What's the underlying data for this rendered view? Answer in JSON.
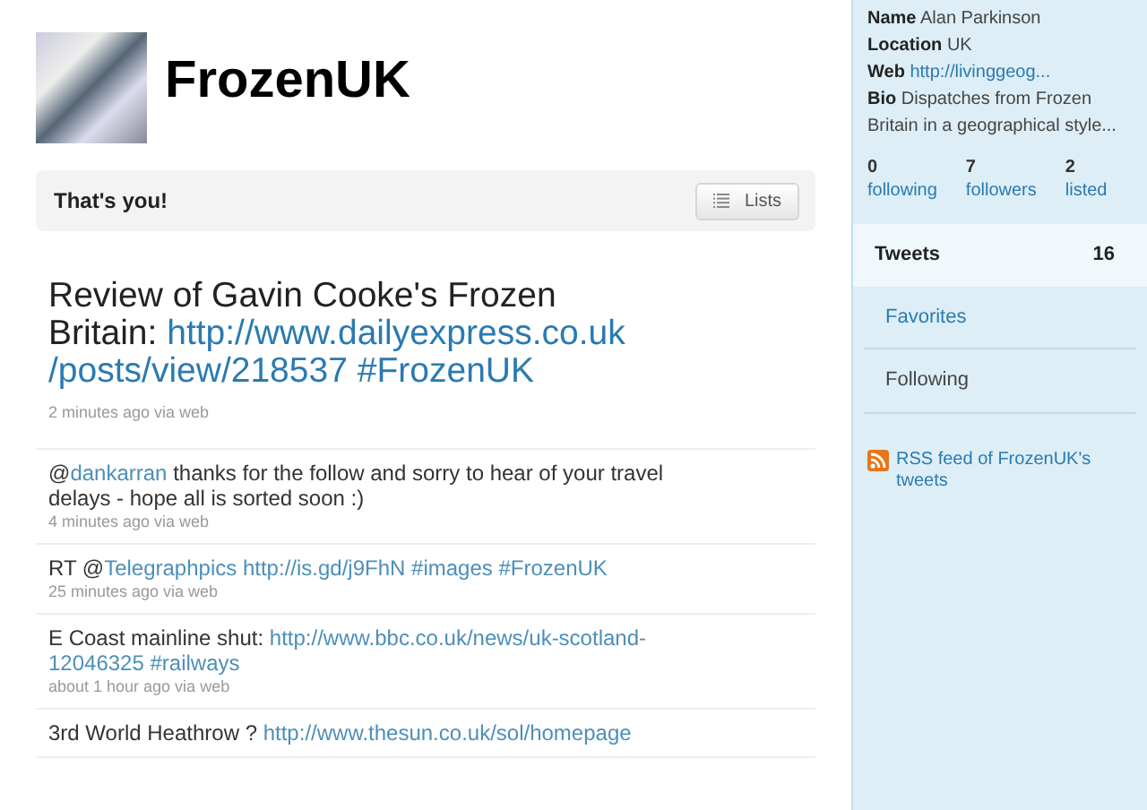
{
  "profile": {
    "name": "FrozenUK",
    "status": "That's you!",
    "lists_button": "Lists"
  },
  "tweets": [
    {
      "parts": [
        {
          "kind": "text",
          "text": "Review of Gavin Cooke's Frozen Britain: "
        },
        {
          "kind": "link",
          "text": "http://www.dailyexpress.co.uk"
        },
        {
          "kind": "link",
          "text": "/posts/view/218537",
          "space_after": true
        },
        {
          "kind": "link",
          "text": "#FrozenUK"
        }
      ],
      "meta": "2 minutes ago via web",
      "featured": true
    },
    {
      "parts": [
        {
          "kind": "text",
          "text": "@"
        },
        {
          "kind": "link",
          "text": "dankarran"
        },
        {
          "kind": "text",
          "text": " thanks for the follow and sorry to hear of your travel delays - hope all is sorted soon :)"
        }
      ],
      "meta": "4 minutes ago via web",
      "featured": false
    },
    {
      "parts": [
        {
          "kind": "text",
          "text": "RT @"
        },
        {
          "kind": "link",
          "text": "Telegraphpics",
          "space_after": true
        },
        {
          "kind": "link",
          "text": "http://is.gd/j9FhN",
          "space_after": true
        },
        {
          "kind": "link",
          "text": "#images",
          "space_after": true
        },
        {
          "kind": "link",
          "text": "#FrozenUK"
        }
      ],
      "meta": "25 minutes ago via web",
      "featured": false
    },
    {
      "parts": [
        {
          "kind": "text",
          "text": "E Coast mainline shut: "
        },
        {
          "kind": "link",
          "text": "http://www.bbc.co.uk/news/uk-scotland-"
        },
        {
          "kind": "link",
          "text": "12046325",
          "space_after": true
        },
        {
          "kind": "link",
          "text": "#railways"
        }
      ],
      "meta": "about 1 hour ago via web",
      "featured": false
    },
    {
      "parts": [
        {
          "kind": "text",
          "text": "3rd World Heathrow ? "
        },
        {
          "kind": "link",
          "text": "http://www.thesun.co.uk/sol/homepage"
        }
      ],
      "featured": false
    }
  ],
  "sidebar": {
    "details": [
      {
        "label": "Name",
        "value": "Alan Parkinson",
        "kind": "text"
      },
      {
        "label": "Location",
        "value": "UK",
        "kind": "text"
      },
      {
        "label": "Web",
        "value": "http://livinggeog...",
        "kind": "link"
      },
      {
        "label": "Bio",
        "value": "Dispatches from Frozen Britain in a geographical style...",
        "kind": "text"
      }
    ],
    "stats": [
      {
        "count": "0",
        "label": "following"
      },
      {
        "count": "7",
        "label": "followers"
      },
      {
        "count": "2",
        "label": "listed"
      }
    ],
    "nav": [
      {
        "label": "Tweets",
        "count": "16",
        "selected": true,
        "kind": "link"
      },
      {
        "label": "Favorites",
        "selected": false,
        "kind": "link"
      },
      {
        "label": "Following",
        "selected": false,
        "kind": "plain"
      }
    ],
    "rss": "RSS feed of FrozenUK's tweets"
  }
}
